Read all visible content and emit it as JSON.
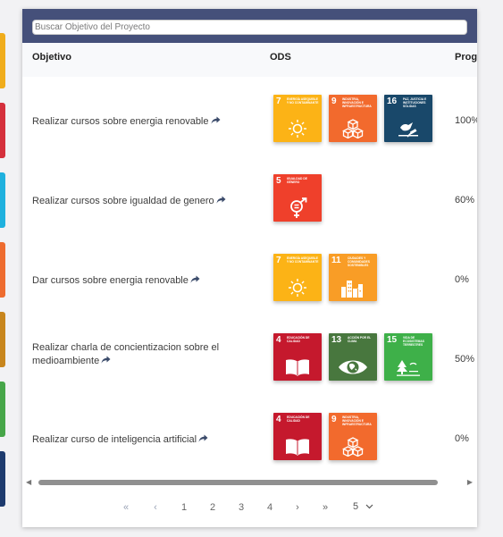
{
  "search": {
    "placeholder": "Buscar Objetivo del Proyecto",
    "value": ""
  },
  "table": {
    "headers": {
      "objetivo": "Objetivo",
      "ods": "ODS",
      "progress": "Prog"
    },
    "rows": [
      {
        "objective": "Realizar cursos sobre energia renovable",
        "ods": [
          {
            "num": "7",
            "label": "Energía asequible y no contaminante",
            "color": "#fcb316",
            "icon": "sun-icon"
          },
          {
            "num": "9",
            "label": "Industria, innovación e infraestructura",
            "color": "#f26a2d",
            "icon": "cubes-icon"
          },
          {
            "num": "16",
            "label": "Paz, justicia e instituciones sólidas",
            "color": "#19486a",
            "icon": "dove-gavel-icon"
          }
        ],
        "progress": "100%"
      },
      {
        "objective": "Realizar cursos sobre igualdad de genero",
        "ods": [
          {
            "num": "5",
            "label": "Igualdad de género",
            "color": "#ef402b",
            "icon": "gender-equality-icon"
          }
        ],
        "progress": "60%"
      },
      {
        "objective": "Dar cursos sobre energia renovable",
        "ods": [
          {
            "num": "7",
            "label": "Energía asequible y no contaminante",
            "color": "#fcb316",
            "icon": "sun-icon"
          },
          {
            "num": "11",
            "label": "Ciudades y comunidades sostenibles",
            "color": "#f99d26",
            "icon": "city-icon"
          }
        ],
        "progress": "0%"
      },
      {
        "objective": "Realizar charla de concientizacion sobre el medioambiente",
        "ods": [
          {
            "num": "4",
            "label": "Educación de calidad",
            "color": "#c5192d",
            "icon": "book-icon"
          },
          {
            "num": "13",
            "label": "Acción por el clima",
            "color": "#48773e",
            "icon": "eye-globe-icon"
          },
          {
            "num": "15",
            "label": "Vida de ecosistemas terrestres",
            "color": "#3eb049",
            "icon": "tree-icon"
          }
        ],
        "progress": "50%"
      },
      {
        "objective": "Realizar curso de inteligencia artificial",
        "ods": [
          {
            "num": "4",
            "label": "Educación de calidad",
            "color": "#c5192d",
            "icon": "book-icon"
          },
          {
            "num": "9",
            "label": "Industria, innovación e infraestructura",
            "color": "#f26a2d",
            "icon": "cubes-icon"
          }
        ],
        "progress": "0%"
      }
    ]
  },
  "pagination": {
    "first": "«",
    "prev": "‹",
    "pages": [
      "1",
      "2",
      "3",
      "4"
    ],
    "next": "›",
    "last": "»",
    "page_size": "5"
  },
  "colors": {
    "header_bg": "#45507a",
    "left_strips": [
      "#f0ad1c",
      "#d5303c",
      "#1fb1de",
      "#ee6c2f",
      "#c8861d",
      "#47a649",
      "#1e3b6e"
    ]
  }
}
